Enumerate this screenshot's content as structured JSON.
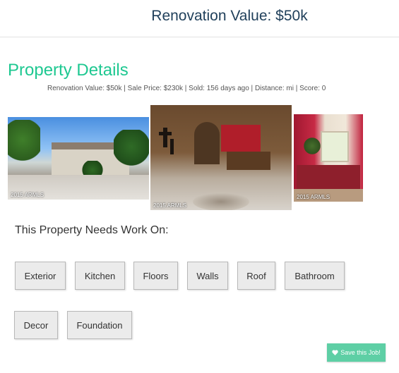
{
  "header": {
    "title": "Renovation Value: $50k"
  },
  "details": {
    "title": "Property Details",
    "stats": [
      "Renovation Value: $50k",
      "Sale Price: $230k",
      "Sold: 156 days ago",
      "Distance: mi",
      "Score: 0"
    ],
    "stats_separator": " | "
  },
  "photos": [
    {
      "caption": "2015 ARMLS"
    },
    {
      "caption": "2015 ARMLS"
    },
    {
      "caption": "2015 ARMLS"
    }
  ],
  "needs": {
    "label": "This Property Needs Work On:",
    "items": [
      "Exterior",
      "Kitchen",
      "Floors",
      "Walls",
      "Roof",
      "Bathroom",
      "Decor",
      "Foundation"
    ]
  },
  "save": {
    "label": "Save this Job!",
    "icon": "heart-icon"
  },
  "colors": {
    "accent": "#1ec891",
    "header_text": "#1f3f5a",
    "save_button": "#5ecfa5"
  }
}
